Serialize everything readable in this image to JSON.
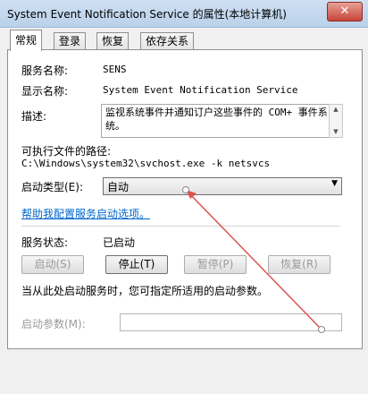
{
  "window": {
    "title": "System Event Notification Service 的属性(本地计算机)",
    "close_label": "✕"
  },
  "tabs": [
    {
      "label": "常规",
      "active": true
    },
    {
      "label": "登录",
      "active": false
    },
    {
      "label": "恢复",
      "active": false
    },
    {
      "label": "依存关系",
      "active": false
    }
  ],
  "general": {
    "service_name_label": "服务名称:",
    "service_name": "SENS",
    "display_name_label": "显示名称:",
    "display_name": "System Event Notification Service",
    "description_label": "描述:",
    "description": "监视系统事件并通知订户这些事件的 COM+ 事件系统。",
    "path_label": "可执行文件的路径:",
    "path": "C:\\Windows\\system32\\svchost.exe -k netsvcs",
    "startup_type_label": "启动类型(E):",
    "startup_type": "自动",
    "help_link": "帮助我配置服务启动选项。",
    "status_label": "服务状态:",
    "status": "已启动",
    "buttons": {
      "start": "启动(S)",
      "stop": "停止(T)",
      "pause": "暂停(P)",
      "resume": "恢复(R)"
    },
    "hint": "当从此处启动服务时，您可指定所适用的启动参数。",
    "params_label": "启动参数(M):",
    "params_value": ""
  },
  "colors": {
    "link": "#0066cc",
    "annotation": "#d9534f"
  }
}
